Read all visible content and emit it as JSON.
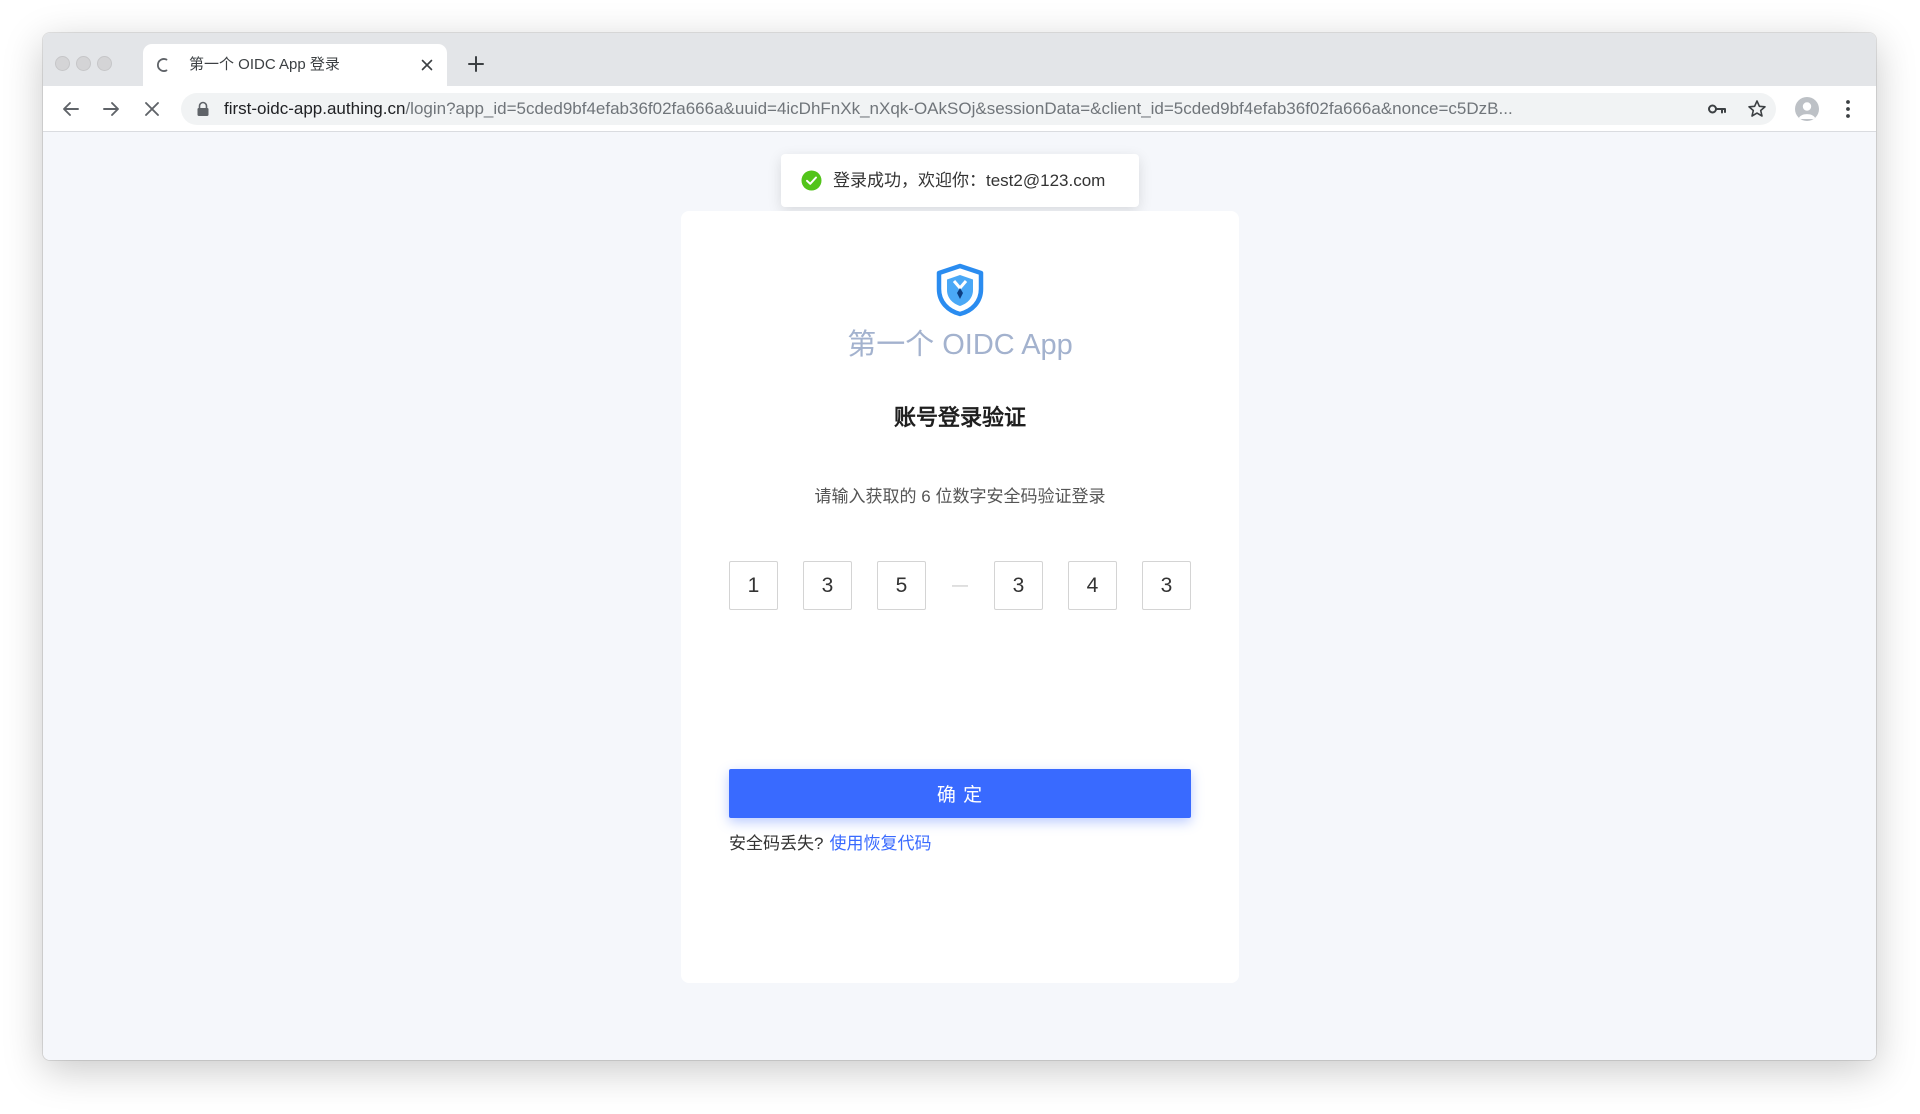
{
  "browser": {
    "tab": {
      "title": "第一个 OIDC App 登录",
      "loading_icon": "loading-spinner-icon",
      "close_icon": "close-icon"
    },
    "new_tab_icon": "plus-icon",
    "nav_icons": [
      "arrow-left-icon",
      "arrow-right-icon",
      "stop-icon"
    ],
    "url": {
      "domain": "first-oidc-app.authing.cn",
      "path": "/login?app_id=5cded9bf4efab36f02fa666a&uuid=4icDhFnXk_nXqk-OAkSOj&sessionData=&client_id=5cded9bf4efab36f02fa666a&nonce=c5DzB..."
    },
    "omnibox_icons": [
      "lock-icon",
      "key-icon",
      "star-icon"
    ],
    "profile_icon": "avatar-icon",
    "menu_icon": "kebab-menu-icon"
  },
  "toast": {
    "icon": "check-circle-icon",
    "message": "登录成功，欢迎你：test2@123.com"
  },
  "card": {
    "logo_icon": "shield-logo-icon",
    "app_name": "第一个 OIDC App",
    "title": "账号登录验证",
    "instruction": "请输入获取的 6 位数字安全码验证登录",
    "code_digits": [
      "1",
      "3",
      "5",
      "3",
      "4",
      "3"
    ],
    "separator": "—",
    "submit_label": "确 定",
    "lost_code_text": "安全码丢失?",
    "recovery_link": "使用恢复代码"
  },
  "colors": {
    "primary": "#396aff",
    "success": "#52c41a",
    "page_background": "#f5f7fb",
    "app_name": "#a3b2ce",
    "logo_blue": "#2a8cf0"
  }
}
